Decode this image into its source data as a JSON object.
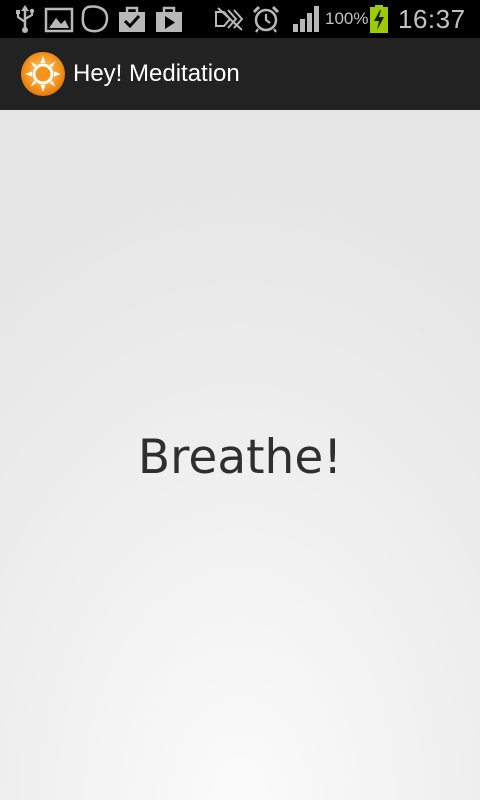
{
  "status_bar": {
    "icons": [
      "usb-icon",
      "gallery-icon",
      "blob-icon",
      "task-done-icon",
      "play-store-icon",
      "no-signal-icon",
      "alarm-icon",
      "signal-icon",
      "battery-charging-icon"
    ],
    "battery_percent": "100%",
    "time": "16:37"
  },
  "action_bar": {
    "title": "Hey! Meditation",
    "icon": "sun-logo-icon",
    "accent_color": "#f7941d"
  },
  "content": {
    "message": "Breathe!"
  }
}
